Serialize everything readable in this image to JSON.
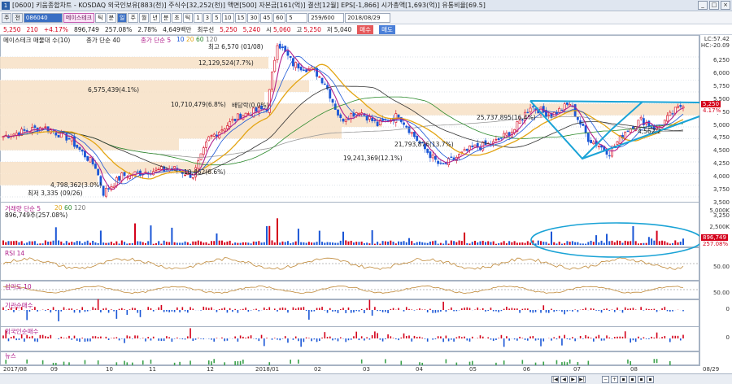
{
  "window": {
    "title": "[0600] 키움종합차트 - KOSDAQ 외국인보유[883(천)] 주식수[32,252(천)] 액면[500] 자본금[161(억)] 결산[12월] EPS[-1,866] 시가총액[1,693(억)] 유통비율[69.5]",
    "icon": "1"
  },
  "toolbar": {
    "period_buttons": [
      "주",
      "전"
    ],
    "code": "086040",
    "stock_name": "메이스테크",
    "buttons": [
      "틱",
      "분",
      "일",
      "주",
      "월",
      "년",
      "분",
      "초",
      "틱"
    ],
    "intervals": [
      "1",
      "3",
      "5",
      "10",
      "15",
      "30",
      "45",
      "60"
    ],
    "interval_sel": "5",
    "count": "259/600",
    "date": "2018/08/29"
  },
  "quote": {
    "price": "5,250",
    "change": "210",
    "rate": "+4.17%",
    "volume": "896,749",
    "vol_rate": "257.08%",
    "turnover": "2.78%",
    "amount": "4,649백만",
    "preferred": "최우선",
    "bid1": "5,250",
    "ask1": "5,240",
    "open_label": "시",
    "open": "5,060",
    "high_label": "고",
    "high": "5,250",
    "low_label": "저",
    "low": "5,040",
    "buy": "매수",
    "sell": "매도"
  },
  "legend": {
    "main": "메이스테크 매물대 수(10)",
    "price": "종가 단순 40",
    "ma": "종가 단순 5",
    "ma_periods": [
      "10",
      "20",
      "60",
      "120"
    ],
    "lc": "LC:57.42",
    "hc": "HC:-20.09"
  },
  "annotations": {
    "high": "최고 6,570 (01/08)",
    "low": "최저 3,335 (09/26)",
    "vp1": "12,129,524(7.7%)",
    "vp2": "6,575,439(4.1%)",
    "vp3": "10,710,479(6.8%)",
    "vp4": "25,737,895(16.4%)",
    "vp5": "21,793,876(13.7%)",
    "vp6": "19,241,369(12.1%)",
    "vp7": "4,798,362(3.0%)",
    "vp8": "10,462(6.6%)",
    "vp9": "4,562,2",
    "label_a": "배당락(0.0%)"
  },
  "price_axis": {
    "labels": [
      "6,250",
      "6,000",
      "5,750",
      "5,500",
      "5,250",
      "5,000",
      "4,750",
      "4,500",
      "4,250",
      "4,000",
      "3,750",
      "3,500",
      "3,250"
    ],
    "current_tag": "5,250",
    "rate_tag": "4.17%"
  },
  "volume_panel": {
    "title": "거래량 단순 5",
    "periods": [
      "20",
      "60",
      "120"
    ],
    "value": "896,749주(257.08%)",
    "axis": [
      "5,000K",
      "2,500K"
    ],
    "tag": "896,749",
    "tag2": "257.08%"
  },
  "rsi_panel": {
    "title": "RSI 14",
    "axis": "50.00"
  },
  "psy_panel": {
    "title": "심리도 10",
    "axis": "50.00"
  },
  "inst_panel": {
    "title": "기관순매수",
    "axis": "0"
  },
  "foreign_panel": {
    "title": "외국인순매수",
    "axis": "0"
  },
  "news_panel": {
    "title": "뉴스"
  },
  "date_axis": {
    "labels": [
      "2017/08",
      "09",
      "10",
      "11",
      "12",
      "2018/01",
      "02",
      "03",
      "04",
      "05",
      "06",
      "07",
      "08",
      "08/29"
    ]
  },
  "colors": {
    "up": "#d4001a",
    "down": "#1a56d6",
    "ma5": "#b0208c",
    "ma20": "#e3a514",
    "ma60": "#2e8b2e",
    "ma40": "#333333",
    "volprofile": "#f7e1c6",
    "trendline": "#1aa3d6"
  }
}
